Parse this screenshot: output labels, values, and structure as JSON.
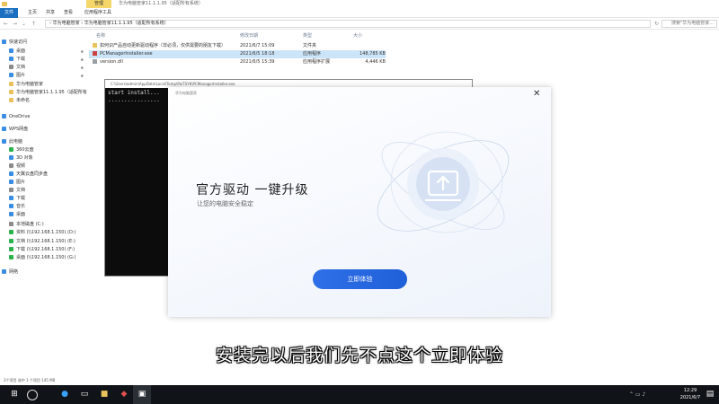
{
  "explorer": {
    "tab_tag": "管理",
    "window_title": "华为电脑管家11.1.1.95（适配所有系统）",
    "ribbon_tabs": [
      "文件",
      "主页",
      "共享",
      "查看",
      "应用程序工具"
    ],
    "address": "› 华为电脑管家 › 华为电脑管家11.1.1.95（适配所有系统）",
    "search_placeholder": "搜索\"华为电脑管家...",
    "columns": [
      "名称",
      "修改日期",
      "类型",
      "大小"
    ],
    "files": [
      {
        "name": "如何识产品自动更新驱动程序（非必须，仅供需要的朋友下载）",
        "date": "2021/6/7 15:09",
        "type": "文件夹",
        "size": ""
      },
      {
        "name": "PCManagerInstaller.exe",
        "date": "2021/6/5 18:18",
        "type": "应用程序",
        "size": "148,785 KB"
      },
      {
        "name": "version.dll",
        "date": "2021/6/5 15:39",
        "type": "应用程序扩展",
        "size": "4,446 KB"
      }
    ],
    "sidebar": [
      {
        "label": "快速访问",
        "pin": false,
        "color": "#3a8de0"
      },
      {
        "label": "桌面",
        "pin": true,
        "color": "#3a8de0"
      },
      {
        "label": "下载",
        "pin": true,
        "color": "#3a8de0"
      },
      {
        "label": "文档",
        "pin": true,
        "color": "#8a8a8a"
      },
      {
        "label": "图片",
        "pin": true,
        "color": "#3a8de0"
      },
      {
        "label": "华为电脑管家",
        "pin": false,
        "color": "#e8c25a"
      },
      {
        "label": "华为电脑管家11.1.1.95（适配所有",
        "pin": false,
        "color": "#e8c25a"
      },
      {
        "label": "未命名",
        "pin": false,
        "color": "#e8c25a"
      },
      {
        "label": "OneDrive",
        "pin": false,
        "color": "#3a8de0"
      },
      {
        "label": "WPS网盘",
        "pin": false,
        "color": "#3a8de0"
      },
      {
        "label": "此电脑",
        "pin": false,
        "color": "#3a8de0"
      },
      {
        "label": "360云盘",
        "pin": false,
        "color": "#2bb24c"
      },
      {
        "label": "3D 对象",
        "pin": false,
        "color": "#3a8de0"
      },
      {
        "label": "视频",
        "pin": false,
        "color": "#8a8a8a"
      },
      {
        "label": "天翼云盘同步盘",
        "pin": false,
        "color": "#3a8de0"
      },
      {
        "label": "图片",
        "pin": false,
        "color": "#3a8de0"
      },
      {
        "label": "文档",
        "pin": false,
        "color": "#8a8a8a"
      },
      {
        "label": "下载",
        "pin": false,
        "color": "#3a8de0"
      },
      {
        "label": "音乐",
        "pin": false,
        "color": "#3a8de0"
      },
      {
        "label": "桌面",
        "pin": false,
        "color": "#3a8de0"
      },
      {
        "label": "本地磁盘 (C:)",
        "pin": false,
        "color": "#8a8a8a"
      },
      {
        "label": "资料 (\\\\192.168.1.150) (D:)",
        "pin": false,
        "color": "#2bb24c"
      },
      {
        "label": "文档 (\\\\192.168.1.150) (E:)",
        "pin": false,
        "color": "#2bb24c"
      },
      {
        "label": "下载 (\\\\192.168.1.150) (F:)",
        "pin": false,
        "color": "#2bb24c"
      },
      {
        "label": "桌面 (\\\\192.168.1.150) (G:)",
        "pin": false,
        "color": "#2bb24c"
      },
      {
        "label": "网络",
        "pin": false,
        "color": "#3a8de0"
      }
    ],
    "status": "3个项目   选中 1 个项目 145 MB"
  },
  "console": {
    "title": "C:\\Users\\admin\\AppData\\Local\\Temp\\PaiTSYK\\PCManagerInstaller.exe",
    "text": "start install...\n................"
  },
  "installer": {
    "title": "华为电脑管家",
    "headline": "官方驱动  一键升级",
    "subtitle": "让您的电脑安全稳定",
    "button": "立即体验",
    "close": "✕"
  },
  "caption": "安装完以后我们先不点这个立即体验",
  "taskbar": {
    "time": "12:29",
    "date": "2021/6/7"
  }
}
